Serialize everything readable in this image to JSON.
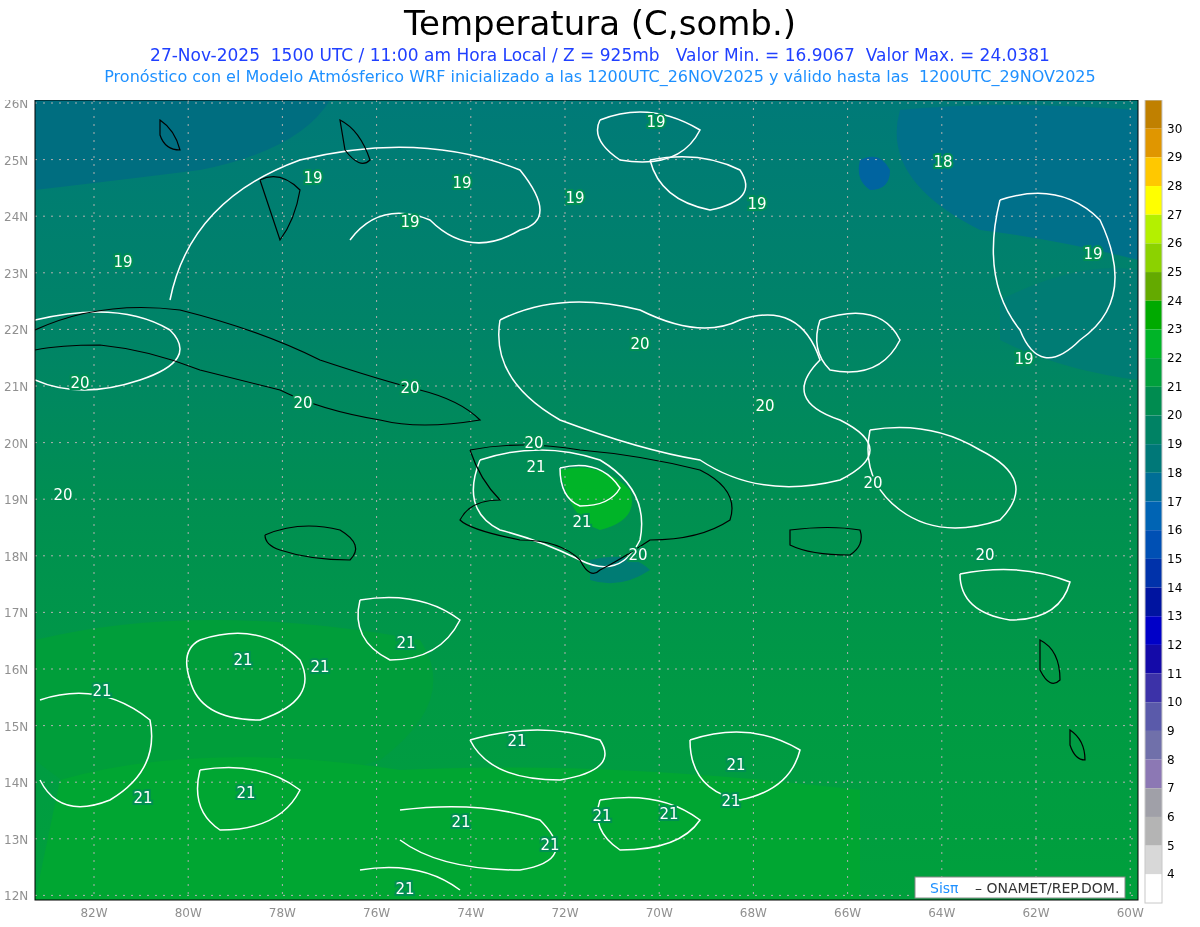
{
  "title": "Temperatura (C,somb.)",
  "subtitle": "27-Nov-2025  1500 UTC / 11:00 am Hora Local / Z = 925mb   Valor Min. = 16.9067  Valor Max. = 24.0381",
  "description": "Pronóstico con el Modelo Atmósferico WRF inicializado a las 1200UTC_26NOV2025 y válido hasta las  1200UTC_29NOV2025",
  "map": {
    "lat_labels": [
      "26N",
      "25N",
      "24N",
      "23N",
      "22N",
      "21N",
      "20N",
      "19N",
      "18N",
      "17N",
      "16N",
      "15N",
      "14N",
      "13N",
      "12N"
    ],
    "lon_labels": [
      "82W",
      "80W",
      "78W",
      "76W",
      "74W",
      "72W",
      "70W",
      "68W",
      "66W",
      "64W",
      "62W",
      "60W"
    ],
    "contour_labels": [
      "19",
      "19",
      "19",
      "19",
      "19",
      "19",
      "19",
      "19",
      "19",
      "18",
      "20",
      "20",
      "20",
      "20",
      "20",
      "20",
      "20",
      "20",
      "20",
      "20",
      "21",
      "21",
      "21",
      "21",
      "21",
      "21",
      "21",
      "21",
      "21",
      "21",
      "21",
      "21",
      "21",
      "21",
      "21",
      "21"
    ],
    "credit": {
      "brand": "Sisπ",
      "text": "– ONAMET/REP.DOM."
    }
  },
  "colorbar": {
    "labels": [
      "30",
      "29",
      "28",
      "27",
      "26",
      "25",
      "24",
      "23",
      "22",
      "21",
      "20",
      "19",
      "18",
      "17",
      "16",
      "15",
      "14",
      "13",
      "12",
      "11",
      "10",
      "9",
      "8",
      "7",
      "6",
      "5",
      "4"
    ],
    "bins": [
      {
        "color": "#c08000"
      },
      {
        "color": "#e09600"
      },
      {
        "color": "#ffc800"
      },
      {
        "color": "#ffff00"
      },
      {
        "color": "#b4f000"
      },
      {
        "color": "#8cd200"
      },
      {
        "color": "#64aa00"
      },
      {
        "color": "#00aa00"
      },
      {
        "color": "#00b428"
      },
      {
        "color": "#00a03c"
      },
      {
        "color": "#008c50"
      },
      {
        "color": "#008264"
      },
      {
        "color": "#007878"
      },
      {
        "color": "#006e96"
      },
      {
        "color": "#0064b4"
      },
      {
        "color": "#0050b4"
      },
      {
        "color": "#0032aa"
      },
      {
        "color": "#0014a0"
      },
      {
        "color": "#0000c8"
      },
      {
        "color": "#140aa8"
      },
      {
        "color": "#3c32a8"
      },
      {
        "color": "#5a5aaa"
      },
      {
        "color": "#7070aa"
      },
      {
        "color": "#8c78b4"
      },
      {
        "color": "#a0a0a8"
      },
      {
        "color": "#b4b4b4"
      },
      {
        "color": "#d8d8d8"
      },
      {
        "color": "#ffffff"
      }
    ]
  }
}
